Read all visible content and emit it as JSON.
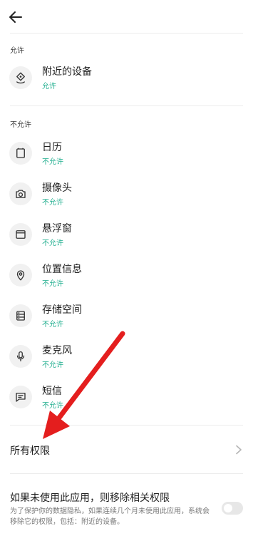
{
  "header": {
    "back_icon": "arrow-left-icon"
  },
  "allowed_section": {
    "title": "允许",
    "items": [
      {
        "icon": "nearby-devices-icon",
        "label": "附近的设备",
        "status": "允许"
      }
    ]
  },
  "denied_section": {
    "title": "不允许",
    "items": [
      {
        "icon": "calendar-icon",
        "label": "日历",
        "status": "不允许"
      },
      {
        "icon": "camera-icon",
        "label": "摄像头",
        "status": "不允许"
      },
      {
        "icon": "floating-window-icon",
        "label": "悬浮窗",
        "status": "不允许"
      },
      {
        "icon": "location-pin-icon",
        "label": "位置信息",
        "status": "不允许"
      },
      {
        "icon": "storage-icon",
        "label": "存储空间",
        "status": "不允许"
      },
      {
        "icon": "microphone-icon",
        "label": "麦克风",
        "status": "不允许"
      },
      {
        "icon": "message-icon",
        "label": "短信",
        "status": "不允许"
      }
    ]
  },
  "all_permissions": {
    "label": "所有权限",
    "icon": "chevron-right-icon"
  },
  "remove_permissions": {
    "title": "如果未使用此应用，则移除相关权限",
    "description": "为了保护你的数据隐私，如果连续几个月未使用此应用，系统会移除它的权限，包括：附近的设备。",
    "toggle_on": false
  },
  "colors": {
    "status_green": "#1fae8e",
    "annotation_red": "#e41e1e"
  }
}
